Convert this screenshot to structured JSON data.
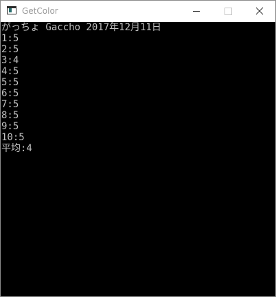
{
  "window": {
    "title": "GetColor",
    "app_icon": "console-app-icon",
    "controls": {
      "minimize_icon": "minimize-icon",
      "maximize_icon": "maximize-icon",
      "close_icon": "close-icon"
    }
  },
  "console": {
    "lines": [
      "がっちょ Gaccho 2017年12月11日",
      "1:5",
      "2:5",
      "3:4",
      "4:5",
      "5:5",
      "6:5",
      "7:5",
      "8:5",
      "9:5",
      "10:5",
      "平均:4"
    ],
    "colors": {
      "background": "#000000",
      "text": "#c0c0c0"
    }
  }
}
